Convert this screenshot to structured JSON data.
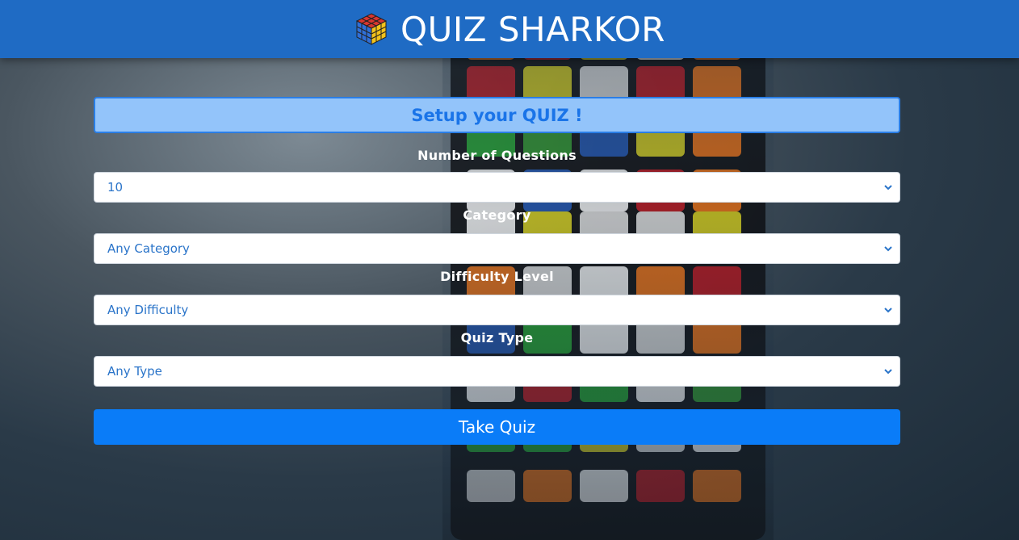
{
  "header": {
    "title": "QUIZ SHARKOR",
    "logo_icon": "rubiks-cube-icon"
  },
  "form": {
    "banner": "Setup your QUIZ !",
    "fields": [
      {
        "label": "Number of Questions",
        "value": "10"
      },
      {
        "label": "Category",
        "value": "Any Category"
      },
      {
        "label": "Difficulty Level",
        "value": "Any Difficulty"
      },
      {
        "label": "Quiz Type",
        "value": "Any Type"
      }
    ],
    "submit_label": "Take Quiz"
  },
  "colors": {
    "header": "#1f6bc4",
    "banner_bg": "#93c4fa",
    "banner_text": "#1a74e8",
    "select_text": "#2a74c9",
    "button": "#0a7cf8"
  }
}
